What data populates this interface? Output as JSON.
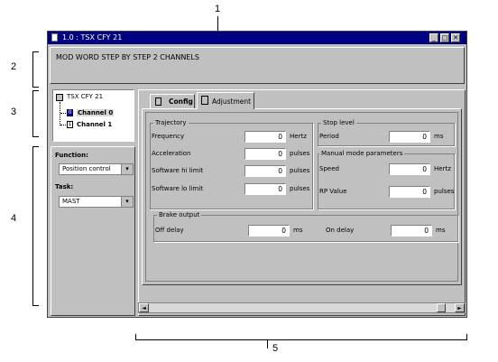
{
  "callouts": {
    "c1": "1",
    "c2": "2",
    "c3": "3",
    "c4": "4",
    "c5": "5"
  },
  "window": {
    "title": "1.0 : TSX CFY 21",
    "minimize": "_",
    "maximize": "□",
    "close": "✕"
  },
  "description": "MOD WORD STEP BY STEP 2 CHANNELS",
  "tree": {
    "root": "TSX CFY 21",
    "channels": [
      {
        "num": "0",
        "label": "Channel 0"
      },
      {
        "num": "1",
        "label": "Channel 1"
      }
    ]
  },
  "function": {
    "label": "Function:",
    "value": "Position control"
  },
  "task": {
    "label": "Task:",
    "value": "MAST"
  },
  "tabs": {
    "config": "Config",
    "adjustment": "Adjustment"
  },
  "trajectory": {
    "title": "Trajectory",
    "rows": [
      {
        "label": "Frequency",
        "value": "0",
        "unit": "Hertz"
      },
      {
        "label": "Acceleration",
        "value": "0",
        "unit": "pulses"
      },
      {
        "label": "Software hi limit",
        "value": "0",
        "unit": "pulses"
      },
      {
        "label": "Software lo limit",
        "value": "0",
        "unit": "pulses"
      }
    ]
  },
  "stop_level": {
    "title": "Stop level",
    "label": "Period",
    "value": "0",
    "unit": "ms"
  },
  "manual": {
    "title": "Manual mode parameters",
    "rows": [
      {
        "label": "Speed",
        "value": "0",
        "unit": "Hertz"
      },
      {
        "label": "RP Value",
        "value": "0",
        "unit": "pulses"
      }
    ]
  },
  "brake": {
    "title": "Brake output",
    "off_delay": {
      "label": "Off delay",
      "value": "0",
      "unit": "ms"
    },
    "on_delay": {
      "label": "On delay",
      "value": "0",
      "unit": "ms"
    }
  },
  "scrollbar": {
    "left": "◄",
    "right": "►"
  }
}
